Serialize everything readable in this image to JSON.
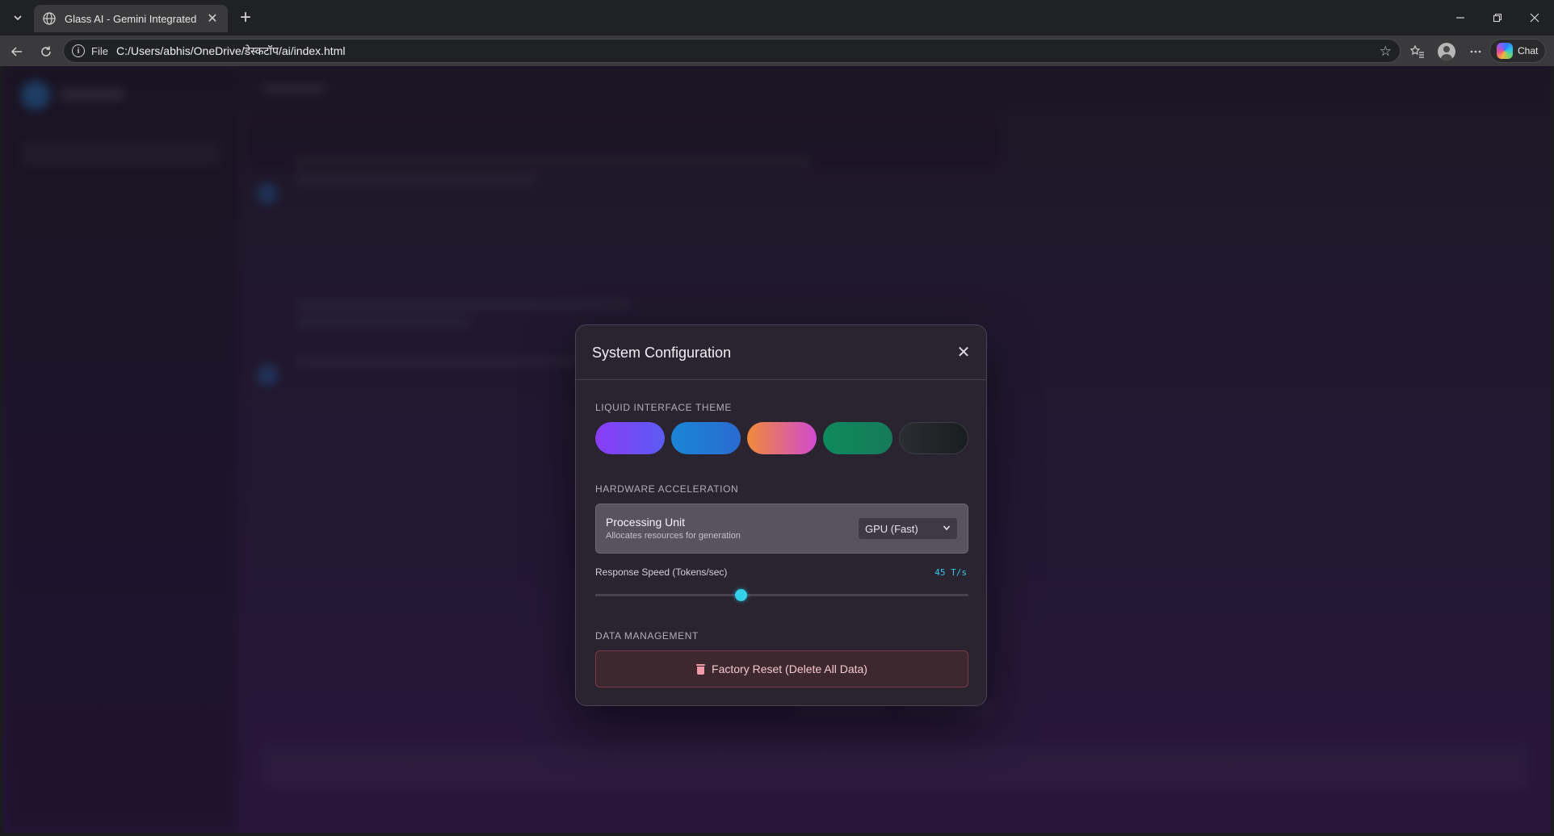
{
  "browser": {
    "tab_title": "Glass AI - Gemini Integrated",
    "url_scheme": "File",
    "url": "C:/Users/abhis/OneDrive/डेस्कटॉप/ai/index.html",
    "chat_label": "Chat"
  },
  "modal": {
    "title": "System Configuration",
    "theme_section": "LIQUID INTERFACE THEME",
    "themes": [
      "violet",
      "blue",
      "sunset",
      "emerald",
      "dark"
    ],
    "hardware_section": "HARDWARE ACCELERATION",
    "processing_unit_title": "Processing Unit",
    "processing_unit_subtitle": "Allocates resources for generation",
    "processing_unit_value": "GPU (Fast)",
    "speed_label": "Response Speed (Tokens/sec)",
    "speed_value": "45 T/s",
    "speed_level": 0.39,
    "data_section": "DATA MANAGEMENT",
    "reset_label": "Factory Reset (Delete All Data)"
  },
  "colors": {
    "accent": "#35d0ea",
    "danger": "#f29aa8"
  }
}
